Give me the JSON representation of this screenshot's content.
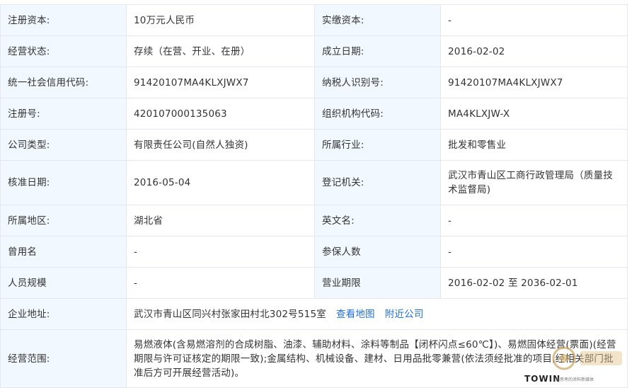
{
  "rows": [
    {
      "l1": "注册资本:",
      "v1": "10万元人民币",
      "l2": "实缴资本:",
      "v2": "-"
    },
    {
      "l1": "经营状态:",
      "v1": "存续（在营、开业、在册）",
      "l2": "成立日期:",
      "v2": "2016-02-02"
    },
    {
      "l1": "统一社会信用代码:",
      "v1": "91420107MA4KLXJWX7",
      "l2": "纳税人识别号:",
      "v2": "91420107MA4KLXJWX7"
    },
    {
      "l1": "注册号:",
      "v1": "420107000135063",
      "l2": "组织机构代码:",
      "v2": "MA4KLXJW-X"
    },
    {
      "l1": "公司类型:",
      "v1": "有限责任公司(自然人独资)",
      "l2": "所属行业:",
      "v2": "批发和零售业"
    },
    {
      "l1": "核准日期:",
      "v1": "2016-05-04",
      "l2": "登记机关:",
      "v2": "武汉市青山区工商行政管理局（质量技术监督局)"
    },
    {
      "l1": "所属地区:",
      "v1": "湖北省",
      "l2": "英文名:",
      "v2": "-"
    },
    {
      "l1": "曾用名",
      "v1": "-",
      "l2": "参保人数",
      "v2": "-"
    },
    {
      "l1": "人员规模",
      "v1": "-",
      "l2": "营业期限",
      "v2": "2016-02-02 至 2036-02-01"
    }
  ],
  "address": {
    "label": "企业地址:",
    "value": "武汉市青山区同兴村张家田村北302号515室",
    "map_link": "查看地图",
    "nearby_link": "附近公司"
  },
  "scope": {
    "label": "经营范围:",
    "value": "易燃液体(含易燃溶剂的合成树脂、油漆、辅助材料、涂料等制品【闭杯闪点≤60℃】)、易燃固体经营(票面)(经营期限与许可证核定的期限一致);金属结构、机械设备、建材、日用品批零兼营(依法须经批准的项目,经相关部门批准后方可开展经营活动)。"
  },
  "watermark": {
    "brand": "TOWIN",
    "tagline": "会思考的涂料新媒体"
  },
  "colors": {
    "label_bg": "#f2f8ff",
    "border": "#e4e7ec",
    "link": "#1f6fd6"
  }
}
